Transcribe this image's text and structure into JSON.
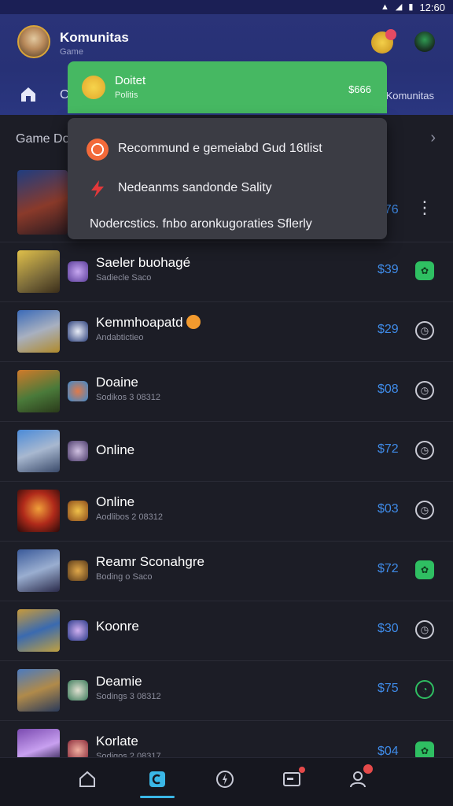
{
  "status_bar": {
    "time": "12:60"
  },
  "header": {
    "title": "Komunitas",
    "subtitle": "Game",
    "nav_left_tab": "C",
    "nav_right_tab": "Komunitas"
  },
  "dropdown_header": {
    "title": "Doitet",
    "subtitle": "Politis",
    "price": "$666"
  },
  "dropdown_menu": [
    {
      "label": "Recommund e gemeiabd Gud 16tlist",
      "icon": "target-icon"
    },
    {
      "label": "Nedeanms sandonde Sality",
      "icon": "lightning-icon"
    },
    {
      "label": "Nodercstics. fnbo aronkugoraties Sflerly",
      "icon": ""
    }
  ],
  "section": {
    "title": "Game Dol"
  },
  "rows": [
    {
      "title": "",
      "subtitle": "",
      "price": "$76",
      "action": "more-icon"
    },
    {
      "title": "Saeler buohagé",
      "subtitle": "Sadiecle Saco",
      "price": "$39",
      "action": "gift-icon"
    },
    {
      "title": "Kemmhoapatd",
      "subtitle": "Andabtictieo",
      "price": "$29",
      "action": "clock-icon"
    },
    {
      "title": "Doaine",
      "subtitle": "Sodikos 3 08312",
      "price": "$08",
      "action": "clock-icon"
    },
    {
      "title": "Online",
      "subtitle": "",
      "price": "$72",
      "action": "clock-icon"
    },
    {
      "title": "Online",
      "subtitle": "Aodlibos 2 08312",
      "price": "$03",
      "action": "clock-icon"
    },
    {
      "title": "Reamr Sconahgre",
      "subtitle": "Boding o Saco",
      "price": "$72",
      "action": "gift-icon"
    },
    {
      "title": "Koonre",
      "subtitle": "",
      "price": "$30",
      "action": "clock-icon"
    },
    {
      "title": "Deamie",
      "subtitle": "Sodings 3 08312",
      "price": "$75",
      "action": "chat-icon"
    },
    {
      "title": "Korlate",
      "subtitle": "Sodigos 2 08317",
      "price": "$04",
      "action": "gift-icon"
    }
  ],
  "colors": {
    "accent_blue": "#3f8be8",
    "header_bg": "#273176",
    "dropdown_green": "#46b862",
    "accent_green": "#2fbf62"
  }
}
